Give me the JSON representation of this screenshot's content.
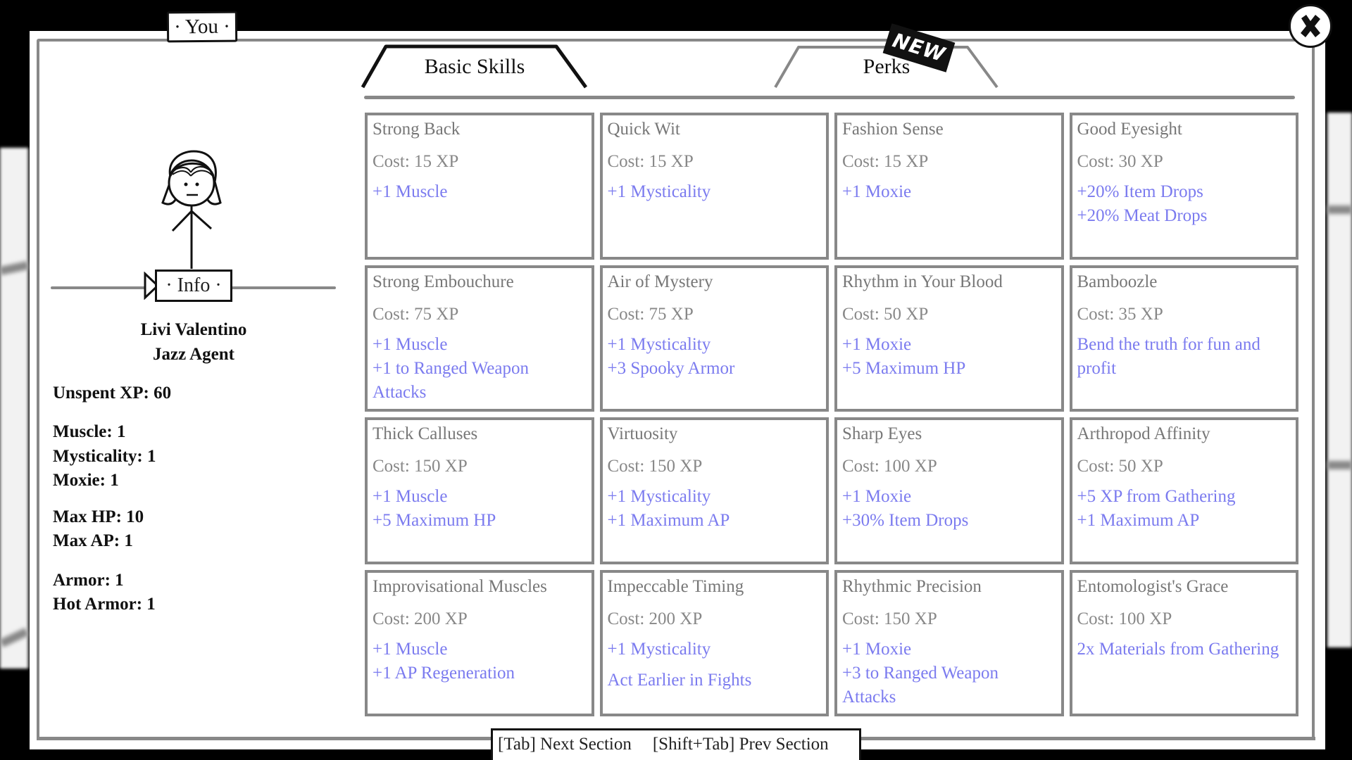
{
  "window": {
    "title_tag": "· You ·",
    "close_icon": "close-x-icon"
  },
  "character": {
    "info_tag": "· Info ·",
    "name": "Livi Valentino",
    "class": "Jazz Agent",
    "stats": {
      "unspent_xp": "Unspent XP: 60",
      "muscle": "Muscle: 1",
      "mysticality": "Mysticality: 1",
      "moxie": "Moxie: 1",
      "max_hp": "Max HP: 10",
      "max_ap": "Max AP: 1",
      "armor": "Armor: 1",
      "hot_armor": "Hot Armor: 1"
    }
  },
  "tabs": [
    {
      "label": "Basic Skills",
      "active": true
    },
    {
      "label": "Perks",
      "active": false,
      "badge": "NEW"
    }
  ],
  "colors": {
    "effect": "#7b7bef",
    "border": "#888888",
    "title": "#777777"
  },
  "skills": [
    {
      "name": "Strong Back",
      "cost": "Cost: 15 XP",
      "effects": [
        "+1 Muscle"
      ]
    },
    {
      "name": "Quick Wit",
      "cost": "Cost: 15 XP",
      "effects": [
        "+1 Mysticality"
      ]
    },
    {
      "name": "Fashion Sense",
      "cost": "Cost: 15 XP",
      "effects": [
        "+1 Moxie"
      ]
    },
    {
      "name": "Good Eyesight",
      "cost": "Cost: 30 XP",
      "effects": [
        "+20% Item Drops",
        "+20% Meat Drops"
      ]
    },
    {
      "name": "Strong Embouchure",
      "cost": "Cost: 75 XP",
      "effects": [
        "+1 Muscle",
        "+1 to Ranged Weapon Attacks"
      ]
    },
    {
      "name": "Air of Mystery",
      "cost": "Cost: 75 XP",
      "effects": [
        "+1 Mysticality",
        "+3 Spooky Armor"
      ]
    },
    {
      "name": "Rhythm in Your Blood",
      "cost": "Cost: 50 XP",
      "effects": [
        "+1 Moxie",
        "+5 Maximum HP"
      ]
    },
    {
      "name": "Bamboozle",
      "cost": "Cost: 35 XP",
      "effects": [
        "Bend the truth for fun and profit"
      ]
    },
    {
      "name": "Thick Calluses",
      "cost": "Cost: 150 XP",
      "effects": [
        "+1 Muscle",
        "+5 Maximum HP"
      ]
    },
    {
      "name": "Virtuosity",
      "cost": "Cost: 150 XP",
      "effects": [
        "+1 Mysticality",
        "+1 Maximum AP"
      ]
    },
    {
      "name": "Sharp Eyes",
      "cost": "Cost: 100 XP",
      "effects": [
        "+1 Moxie",
        "+30% Item Drops"
      ]
    },
    {
      "name": "Arthropod Affinity",
      "cost": "Cost: 50 XP",
      "effects": [
        "+5 XP from Gathering",
        "+1 Maximum AP"
      ]
    },
    {
      "name": "Improvisational Muscles",
      "cost": "Cost: 200 XP",
      "effects": [
        "+1 Muscle",
        "+1 AP Regeneration"
      ]
    },
    {
      "name": "Impeccable Timing",
      "cost": "Cost: 200 XP",
      "effects": [
        "+1 Mysticality",
        "Act Earlier in Fights"
      ]
    },
    {
      "name": "Rhythmic Precision",
      "cost": "Cost: 150 XP",
      "effects": [
        "+1 Moxie",
        "+3 to Ranged Weapon Attacks"
      ]
    },
    {
      "name": "Entomologist's Grace",
      "cost": "Cost: 100 XP",
      "effects": [
        "2x Materials from Gathering"
      ]
    }
  ],
  "footer": {
    "next": "[Tab]  Next Section",
    "prev": "[Shift+Tab] Prev Section"
  }
}
